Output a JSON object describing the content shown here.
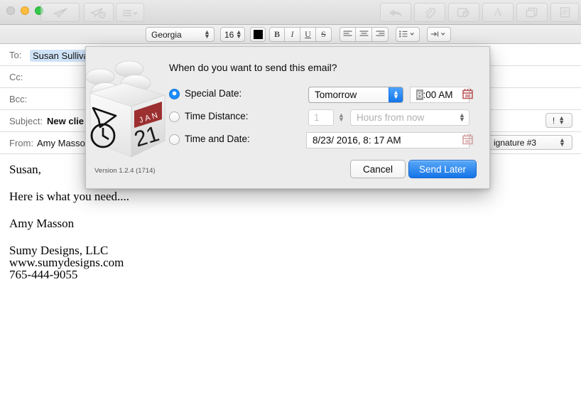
{
  "window": {
    "traffic_lights": [
      "close",
      "minimize",
      "zoom"
    ],
    "toolbar_left": [
      {
        "name": "send-button",
        "icon": "paper-plane-icon",
        "label": "Send"
      },
      {
        "name": "send-later-button",
        "icon": "paper-plane-clock-icon",
        "label": "Send Later"
      },
      {
        "name": "list-options-button",
        "icon": "list-chevron-icon",
        "label": "Options"
      }
    ],
    "toolbar_right": [
      {
        "name": "reply-button",
        "icon": "reply-arrow-icon",
        "label": "Reply"
      },
      {
        "name": "attach-button",
        "icon": "paperclip-icon",
        "label": "Attach"
      },
      {
        "name": "attach-card-button",
        "icon": "attachment-card-icon",
        "label": "Insert Attachment"
      },
      {
        "name": "format-button",
        "icon": "letter-a-icon",
        "label": "Format"
      },
      {
        "name": "photo-browser-button",
        "icon": "windows-stack-icon",
        "label": "Photo Browser"
      },
      {
        "name": "stationery-button",
        "icon": "stationery-icon",
        "label": "Stationery"
      }
    ]
  },
  "format_bar": {
    "font_family": "Georgia",
    "font_size": "16",
    "color_swatch": "#000000",
    "bold": "B",
    "italic": "I",
    "underline": "U",
    "strikethrough": "S",
    "align_left": "align-left",
    "align_center": "align-center",
    "align_right": "align-right",
    "lists": "lists",
    "indent": "indent"
  },
  "headers": [
    {
      "key": "To:",
      "value": "Susan Sulliva",
      "token": true,
      "name": "to-field"
    },
    {
      "key": "Cc:",
      "value": "",
      "token": false,
      "name": "cc-field"
    },
    {
      "key": "Bcc:",
      "value": "",
      "token": false,
      "name": "bcc-field"
    },
    {
      "key": "Subject:",
      "value": "New clie",
      "token": false,
      "name": "subject-field"
    },
    {
      "key": "From:",
      "value": "Amy Masso",
      "token": false,
      "name": "from-field"
    }
  ],
  "priority": {
    "label": "!",
    "name": "priority-selector"
  },
  "signature": {
    "value": "ignature #3",
    "name": "signature-selector"
  },
  "body": {
    "lines": [
      "Susan,",
      "",
      "Here is what you need....",
      "",
      "Amy Masson",
      "",
      "Sumy Designs, LLC",
      "www.sumydesigns.com",
      "765-444-9055"
    ]
  },
  "dialog": {
    "question": "When do you want to send this email?",
    "version": "Version 1.2.4 (1714)",
    "app_icon": {
      "name": "sendlater-lego-brick-icon",
      "calendar_month": "JAN",
      "calendar_day": "21",
      "calendar_color": "#9c3030"
    },
    "options": [
      {
        "id": "special-date",
        "label": "Special Date:",
        "selected": true,
        "popup_value": "Tomorrow",
        "time_value_selected": "8",
        "time_value_rest": ":00 AM"
      },
      {
        "id": "time-distance",
        "label": "Time Distance:",
        "selected": false,
        "amount": "1",
        "unit_value": "Hours from now"
      },
      {
        "id": "time-and-date",
        "label": "Time and Date:",
        "selected": false,
        "datetime_value": "8/23/ 2016,  8: 17 AM"
      }
    ],
    "cancel_label": "Cancel",
    "confirm_label": "Send Later",
    "accent_color": "#1573e6"
  }
}
